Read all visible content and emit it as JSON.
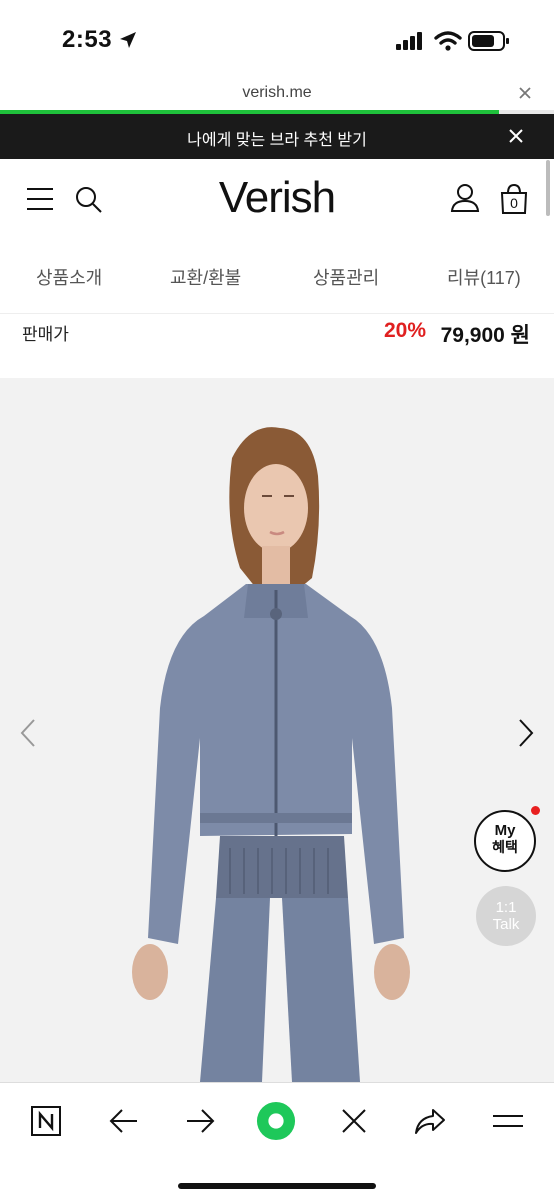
{
  "status_bar": {
    "time": "2:53"
  },
  "browser": {
    "url": "verish.me",
    "load_progress": 0.9
  },
  "promo": {
    "text": "나에게 맞는 브라 추천 받기"
  },
  "header": {
    "logo": "Verish",
    "cart_count": "0"
  },
  "tabs": [
    {
      "label": "상품소개"
    },
    {
      "label": "교환/환불"
    },
    {
      "label": "상품관리"
    },
    {
      "label": "리뷰(117)"
    }
  ],
  "price": {
    "label": "판매가",
    "discount": "20%",
    "amount": "79,900 원"
  },
  "floating": {
    "benefit_line1": "My",
    "benefit_line2": "혜택",
    "talk_line1": "1:1",
    "talk_line2": "Talk"
  },
  "colors": {
    "accent_green": "#1fc13b",
    "discount_red": "#e02020",
    "banner_bg": "#1a1a1a"
  }
}
